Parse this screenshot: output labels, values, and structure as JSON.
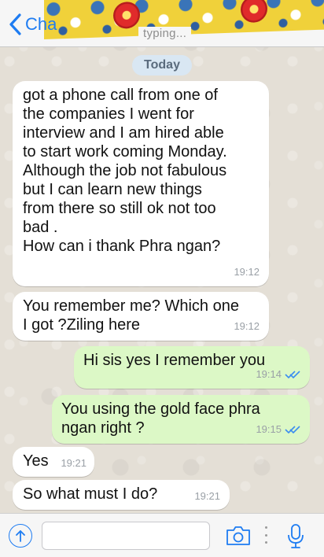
{
  "header": {
    "back_label": "Cha",
    "status": "typing...",
    "accent_color": "#1e7cf2"
  },
  "date_separator": "Today",
  "messages": [
    {
      "direction": "incoming",
      "text": "got a phone call from one of\nthe companies I went for\ninterview and I am hired able\nto start work coming Monday.\nAlthough the job not fabulous\nbut I can learn new things\nfrom there so still ok not too\nbad .\nHow can i thank Phra ngan?",
      "time": "19:12"
    },
    {
      "direction": "incoming",
      "text": "You remember me? Which one\nI got ?Ziling here",
      "time": "19:12"
    },
    {
      "direction": "outgoing",
      "text": "Hi sis yes I remember you",
      "time": "19:14",
      "status_icon": "double-check-icon"
    },
    {
      "direction": "outgoing",
      "text": "You using the gold face phra\nngan right ?",
      "time": "19:15",
      "status_icon": "double-check-icon"
    },
    {
      "direction": "incoming",
      "text": "Yes",
      "time": "19:21"
    },
    {
      "direction": "incoming",
      "text": "So what must I do?",
      "time": "19:21"
    }
  ],
  "input_bar": {
    "message_value": "",
    "icons": [
      "share-icon",
      "camera-icon",
      "microphone-icon"
    ]
  },
  "colors": {
    "incoming_bubble": "#ffffff",
    "outgoing_bubble": "#dcf8c6",
    "read_tick": "#3b8df0"
  }
}
